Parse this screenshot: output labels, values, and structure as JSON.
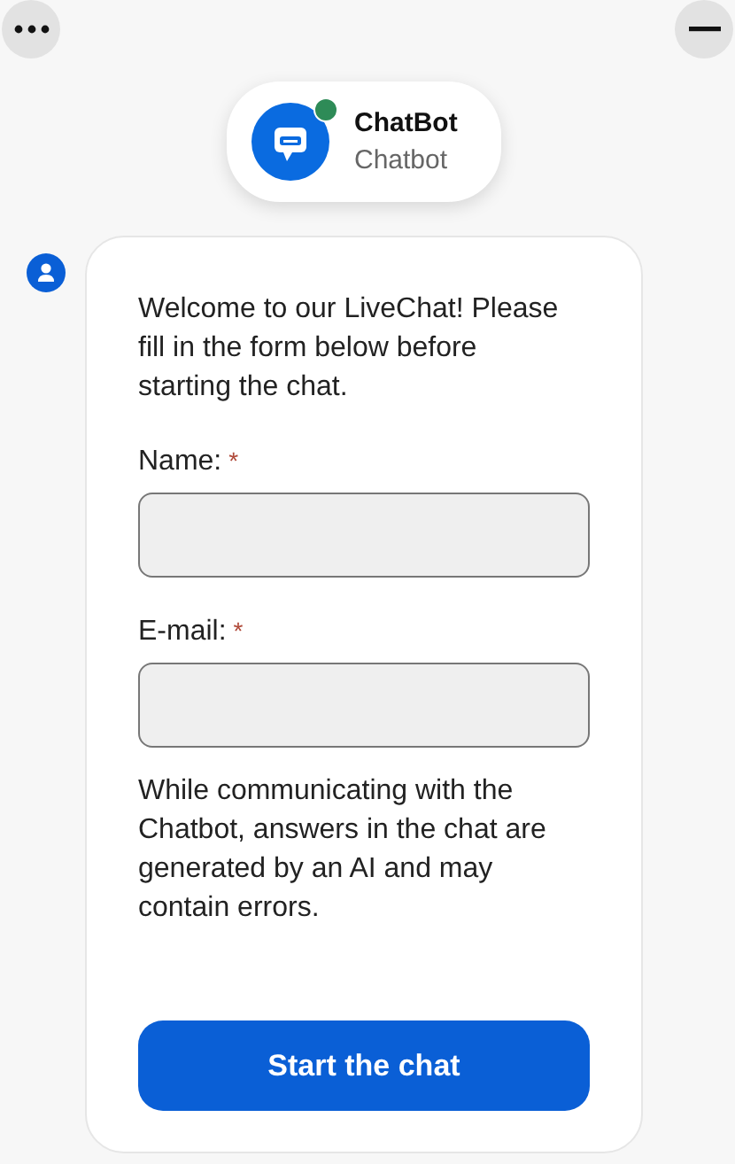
{
  "bot": {
    "name": "ChatBot",
    "subtitle": "Chatbot",
    "online": true
  },
  "welcome": "Welcome to our LiveChat! Please fill in the form below before starting the chat.",
  "fields": [
    {
      "label": "Name:",
      "required": true,
      "required_mark": "*"
    },
    {
      "label": "E-mail:",
      "required": true,
      "required_mark": "*"
    }
  ],
  "disclaimer": "While communicating with the Chatbot, answers in the chat are generated by an AI and may contain errors.",
  "submit": "Start the chat"
}
